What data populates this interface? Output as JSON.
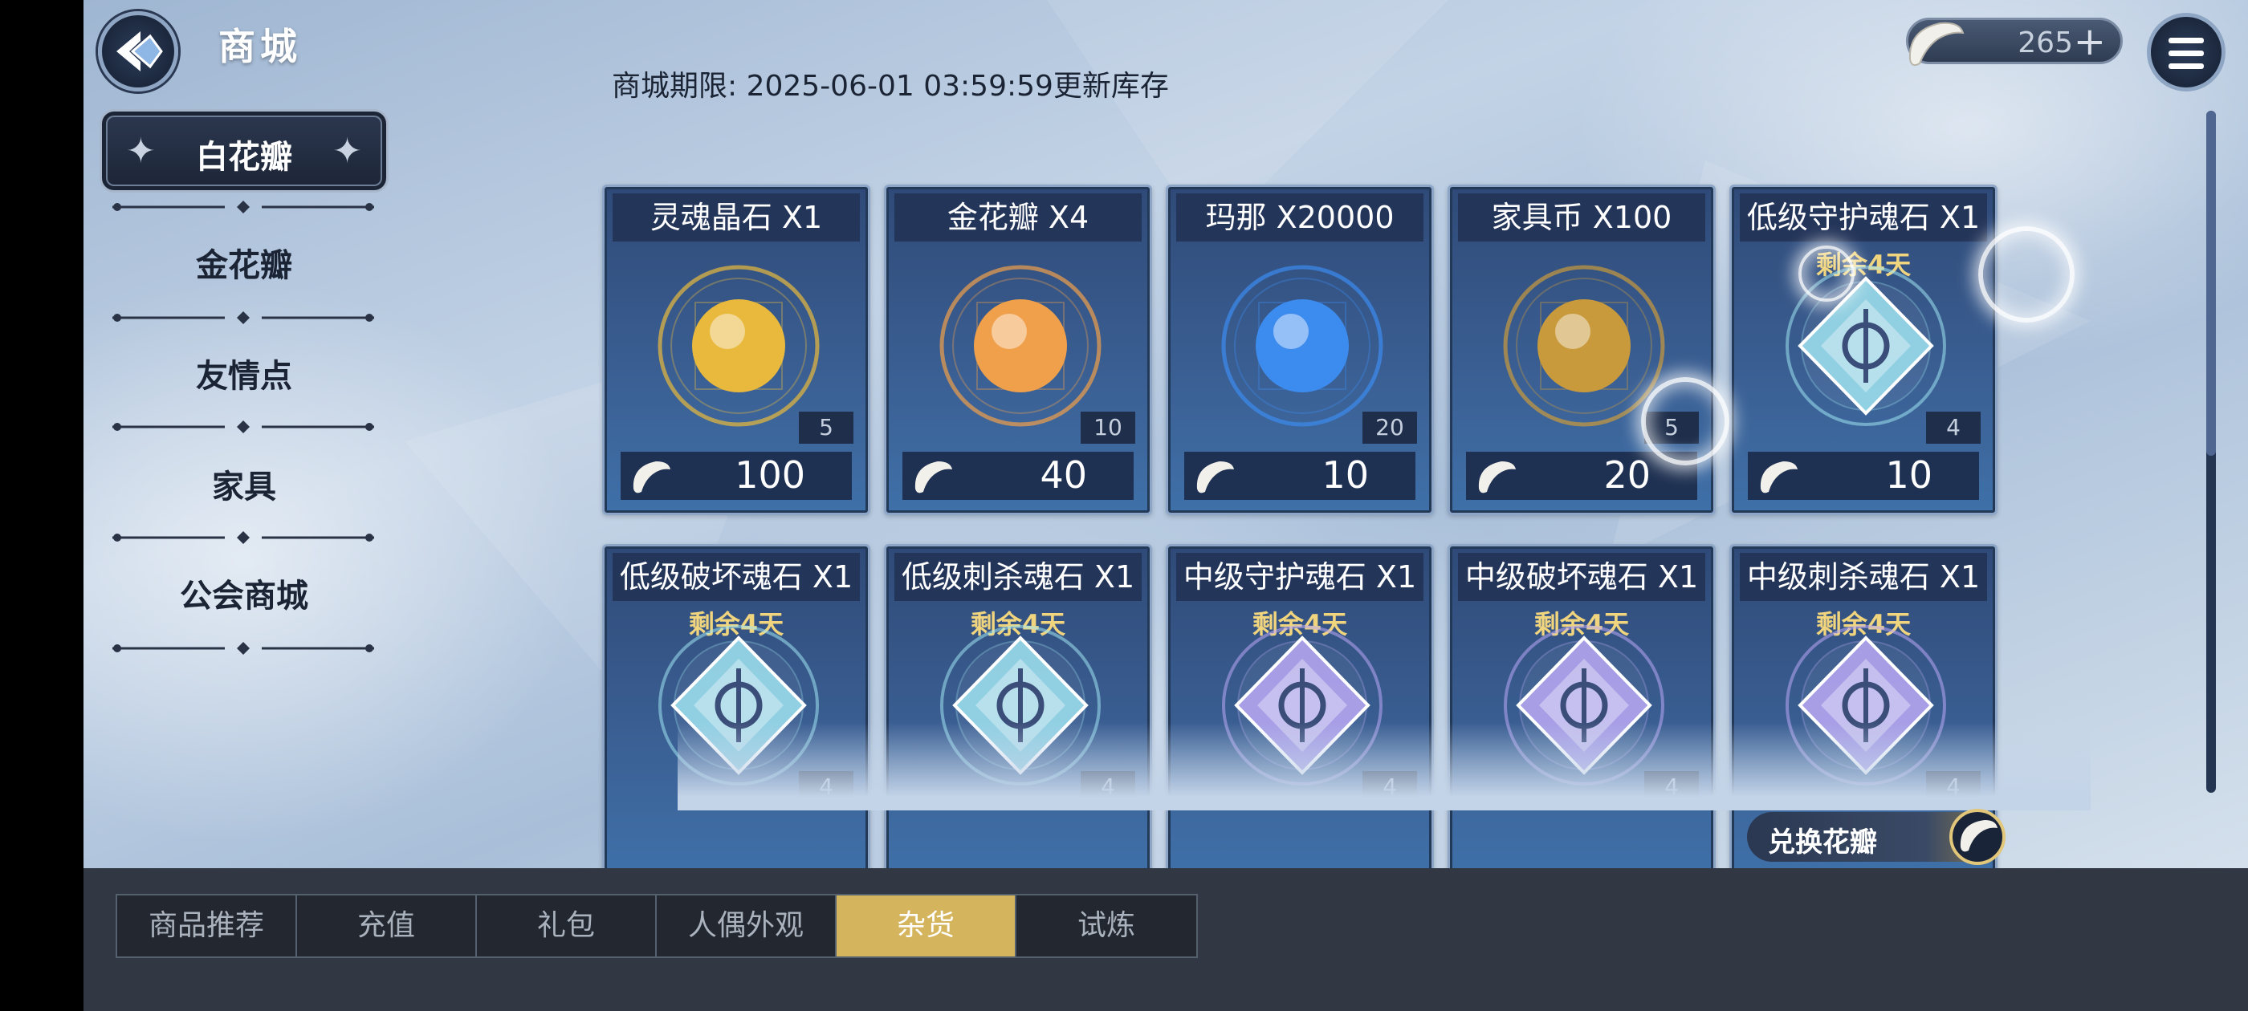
{
  "header": {
    "title": "商城",
    "expiry": "商城期限:  2025-06-01 03:59:59更新库存"
  },
  "currency": {
    "amount": "265",
    "plus": "+",
    "icon": "white-petal-icon"
  },
  "sidebar": {
    "active": "白花瓣",
    "items": [
      "金花瓣",
      "友情点",
      "家具",
      "公会商城"
    ]
  },
  "cards": [
    {
      "name": "灵魂晶石 X1",
      "remain": "",
      "stock": "5",
      "price": "100",
      "art": "soul-crystal-icon",
      "color": "#e8b93c"
    },
    {
      "name": "金花瓣 X4",
      "remain": "",
      "stock": "10",
      "price": "40",
      "art": "gold-petal-icon",
      "color": "#f0a04a"
    },
    {
      "name": "玛那 X20000",
      "remain": "",
      "stock": "20",
      "price": "10",
      "art": "mana-orb-icon",
      "color": "#3c8cf0"
    },
    {
      "name": "家具币 X100",
      "remain": "",
      "stock": "5",
      "price": "20",
      "art": "furniture-coin-icon",
      "color": "#c99a3c"
    },
    {
      "name": "低级守护魂石 X1",
      "remain": "剩余4天",
      "stock": "4",
      "price": "10",
      "art": "guard-soulstone-icon",
      "color": "#9fe3f0"
    },
    {
      "name": "低级破坏魂石 X1",
      "remain": "剩余4天",
      "stock": "4",
      "price": "",
      "art": "destroy-soulstone-icon",
      "color": "#9fe3f0"
    },
    {
      "name": "低级刺杀魂石 X1",
      "remain": "剩余4天",
      "stock": "4",
      "price": "",
      "art": "assassin-soulstone-icon",
      "color": "#9fe3f0"
    },
    {
      "name": "中级守护魂石 X1",
      "remain": "剩余4天",
      "stock": "4",
      "price": "",
      "art": "guard-soulstone-icon",
      "color": "#b9a8f5"
    },
    {
      "name": "中级破坏魂石 X1",
      "remain": "剩余4天",
      "stock": "4",
      "price": "",
      "art": "destroy-soulstone-icon",
      "color": "#b9a8f5"
    },
    {
      "name": "中级刺杀魂石 X1",
      "remain": "剩余4天",
      "stock": "4",
      "price": "",
      "art": "assassin-soulstone-icon",
      "color": "#b9a8f5"
    }
  ],
  "exchange": {
    "label": "兑换花瓣"
  },
  "tabs": [
    "商品推荐",
    "充值",
    "礼包",
    "人偶外观",
    "杂货",
    "试炼"
  ],
  "activeTab": 4
}
